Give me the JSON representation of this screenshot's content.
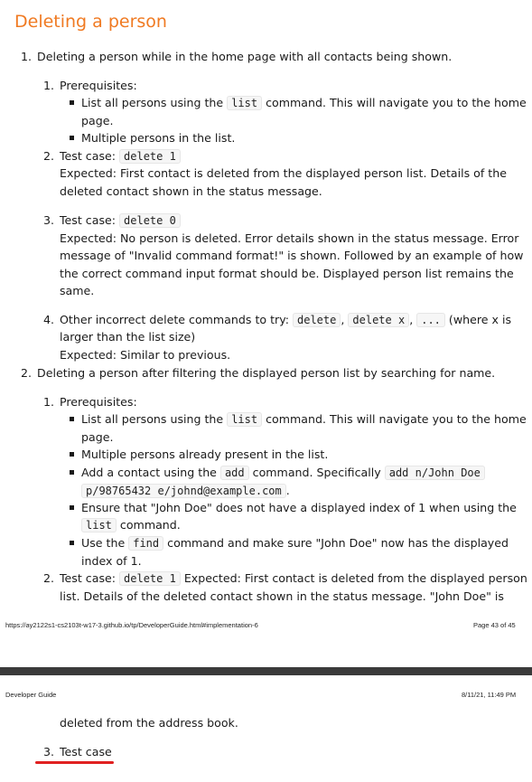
{
  "heading": "Deleting a person",
  "item1": {
    "num": "1.",
    "text": "Deleting a person while in the home page with all contacts being shown.",
    "sub1": {
      "num": "1.",
      "label": "Prerequisites:",
      "b1_pre": "List all persons using the",
      "b1_code": "list",
      "b1_post": "command. This will navigate you to the home",
      "b1_cont": "page.",
      "b2": "Multiple persons in the list."
    },
    "sub2": {
      "num": "2.",
      "label": "Test case:",
      "code": "delete 1",
      "l1": "Expected: First contact is deleted from the displayed person list. Details of the",
      "l2": "deleted contact shown in the status message."
    },
    "sub3": {
      "num": "3.",
      "label": "Test case:",
      "code": "delete 0",
      "l1": "Expected: No person is deleted. Error details shown in the status message. Error",
      "l2": "message of \"Invalid command format!\" is shown. Followed by an example of how",
      "l3": "the correct command input format should be. Displayed person list remains the",
      "l4": "same."
    },
    "sub4": {
      "num": "4.",
      "pre": "Other incorrect delete commands to try:",
      "c1": "delete",
      "c2": "delete x",
      "c3": "...",
      "sep": ",",
      "post": "(where x is",
      "l2": "larger than the list size)",
      "l3": "Expected: Similar to previous."
    }
  },
  "item2": {
    "num": "2.",
    "text": "Deleting a person after filtering the displayed person list by searching for name.",
    "sub1": {
      "num": "1.",
      "label": "Prerequisites:",
      "b1_pre": "List all persons using the",
      "b1_code": "list",
      "b1_post": "command. This will navigate you to the home",
      "b1_cont": "page.",
      "b2": "Multiple persons already present in the list.",
      "b3_pre": "Add a contact using the",
      "b3_code1": "add",
      "b3_mid": "command. Specifically",
      "b3_code2": "add n/John Doe",
      "b3_code3": "p/98765432 e/johnd@example.com",
      "b3_end": ".",
      "b4_pre": "Ensure that \"John Doe\" does not have a displayed index of 1 when using the",
      "b4_code": "list",
      "b4_post": "command.",
      "b5_pre": "Use the",
      "b5_code": "find",
      "b5_post": "command and make sure \"John Doe\" now has the displayed",
      "b5_cont": "index of 1."
    },
    "sub2": {
      "num": "2.",
      "label": "Test case:",
      "code": "delete 1",
      "post": "Expected: First contact is deleted from the displayed person",
      "l2": "list. Details of the deleted contact shown in the status message. \"John Doe\" is",
      "l3": "deleted from the address book."
    },
    "sub3": {
      "num": "3.",
      "label": "Test case"
    }
  },
  "footer": {
    "url": "https://ay2122s1-cs2103t-w17-3.github.io/tp/DeveloperGuide.html#implementation-6",
    "page": "Page 43 of 45"
  },
  "header": {
    "title": "Developer Guide",
    "datetime": "8/11/21, 11:49 PM"
  }
}
